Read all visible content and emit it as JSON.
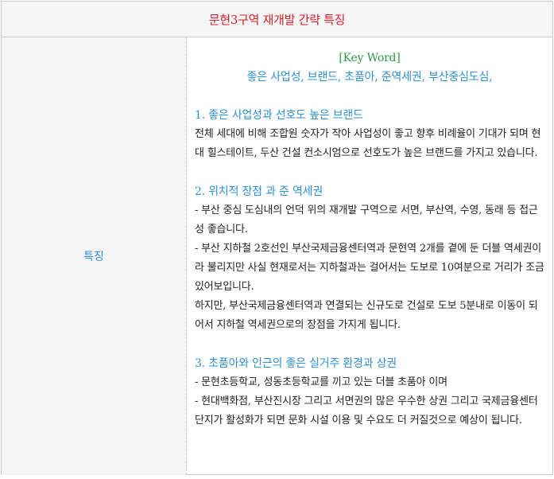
{
  "table": {
    "title": "문현3구역 재개발 간략 특징",
    "label": "특징"
  },
  "keywords": {
    "heading": "[Key Word]",
    "list": "좋은 사업성, 브랜드, 초품아, 준역세권, 부산중심도심,"
  },
  "sections": [
    {
      "heading": "1. 좋은 사업성과 선호도 높은 브랜드",
      "lines": [
        "전체 세대에 비해 조합원 숫자가 작아 사업성이 좋고 향후 비례율이 기대가 되며 현대 힐스테이트, 두산 건설 컨소시엄으로 선호도가 높은 브랜드를 가지고 있습니다."
      ]
    },
    {
      "heading": "2. 위치적 장점 과 준 역세권",
      "lines": [
        "- 부산 중심 도심내의 언덕 위의 재개발 구역으로 서면, 부산역, 수영, 동래 등 접근성 좋습니다.",
        "- 부산 지하철 2호선인 부산국제금융센터역과 문현역 2개를 곁에 둔 더블 역세권이라 불리지만 사실 현재로서는 지하철과는 걸어서는 도보로 10여분으로 거리가 조금 있어보입니다.",
        "하지만, 부산국제금융센터역과 연결되는 신규도로 건설로 도보 5분내로 이동이 되어서 지하철 역세권으로의 장점을 가지게 됩니다."
      ]
    },
    {
      "heading": "3. 초품아와 인근의 좋은 실거주 환경과 상권",
      "lines": [
        "- 문현초등학교, 성동초등학교를 끼고 있는 더블 초품아 이며",
        "- 현대백화점, 부산진시장 그리고 서면권의 많은 우수한 상권 그리고 국제금융센터단지가 활성화가 되면 문화 시설 이용 및 수요도 더 커질것으로 예상이 됩니다."
      ]
    }
  ],
  "colors": {
    "title": "#d8202a",
    "heading_blue": "#2f8fd6",
    "keyword_green": "#2e9a44",
    "body_text": "#222222",
    "cell_bg": "#f5f5f5",
    "border": "#c9c9c9"
  }
}
